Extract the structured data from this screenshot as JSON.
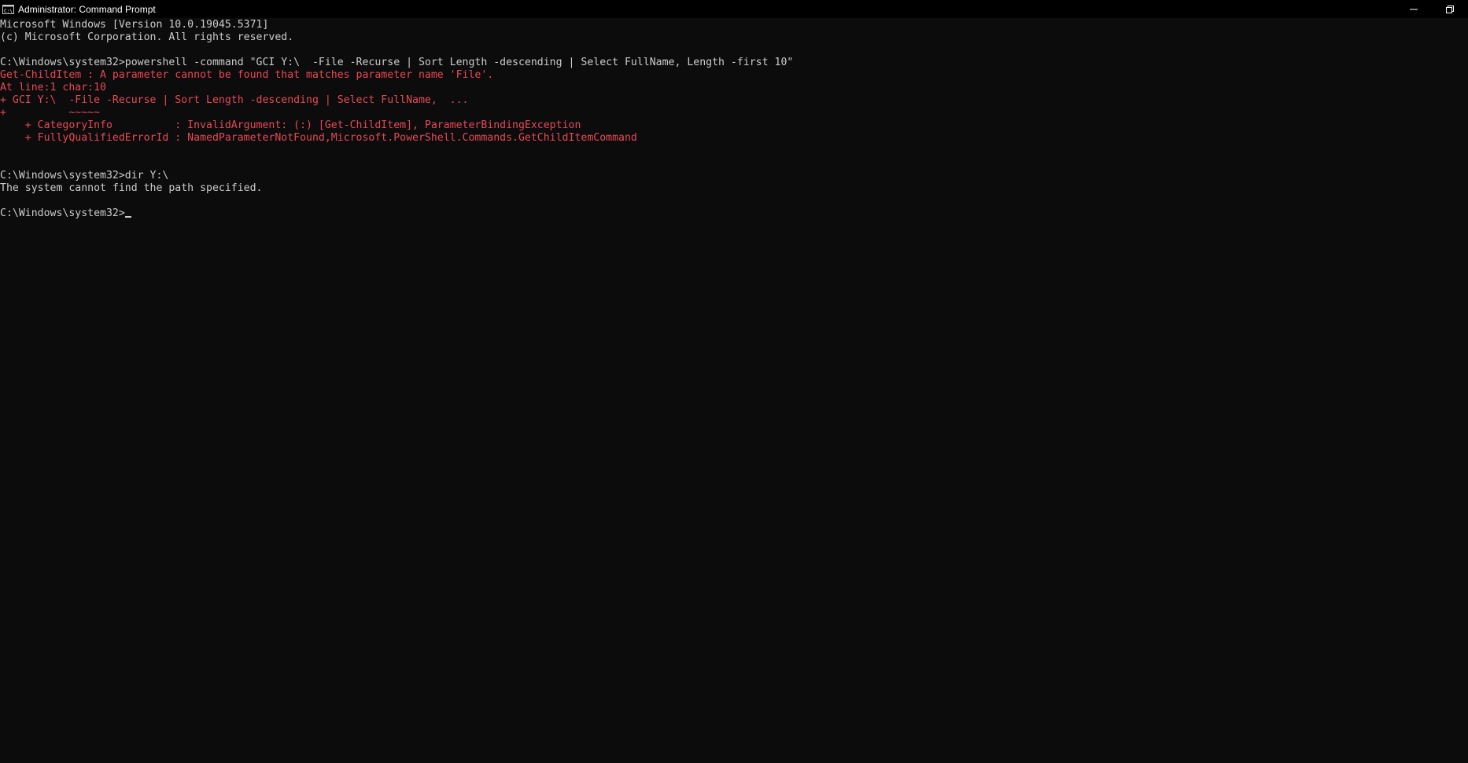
{
  "window": {
    "title": "Administrator: Command Prompt",
    "colors": {
      "background": "#0c0c0c",
      "titlebar": "#000000",
      "text": "#cccccc",
      "error_text": "#e74856"
    },
    "icons": [
      "cmd-app-icon",
      "minimize-icon",
      "restore-icon"
    ]
  },
  "console": {
    "lines": [
      {
        "text": "Microsoft Windows [Version 10.0.19045.5371]",
        "type": "normal"
      },
      {
        "text": "(c) Microsoft Corporation. All rights reserved.",
        "type": "normal"
      },
      {
        "text": "",
        "type": "normal"
      },
      {
        "text": "C:\\Windows\\system32>powershell -command \"GCI Y:\\  -File -Recurse | Sort Length -descending | Select FullName, Length -first 10\"",
        "type": "normal"
      },
      {
        "text": "Get-ChildItem : A parameter cannot be found that matches parameter name 'File'.",
        "type": "error"
      },
      {
        "text": "At line:1 char:10",
        "type": "error"
      },
      {
        "text": "+ GCI Y:\\  -File -Recurse | Sort Length -descending | Select FullName,  ...",
        "type": "error"
      },
      {
        "text": "+          ~~~~~",
        "type": "error"
      },
      {
        "text": "    + CategoryInfo          : InvalidArgument: (:) [Get-ChildItem], ParameterBindingException",
        "type": "error"
      },
      {
        "text": "    + FullyQualifiedErrorId : NamedParameterNotFound,Microsoft.PowerShell.Commands.GetChildItemCommand",
        "type": "error"
      },
      {
        "text": "",
        "type": "normal"
      },
      {
        "text": "",
        "type": "normal"
      },
      {
        "text": "C:\\Windows\\system32>dir Y:\\",
        "type": "normal"
      },
      {
        "text": "The system cannot find the path specified.",
        "type": "normal"
      },
      {
        "text": "",
        "type": "normal"
      }
    ],
    "prompt": "C:\\Windows\\system32>",
    "input": ""
  }
}
